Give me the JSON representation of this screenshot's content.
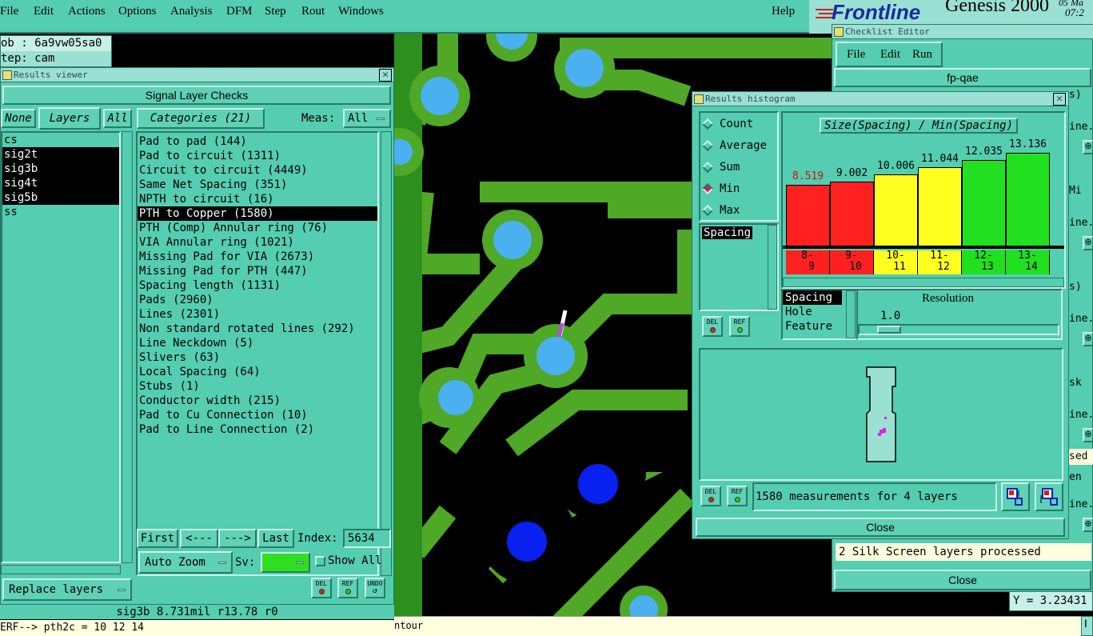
{
  "menubar": {
    "items": [
      "File",
      "Edit",
      "Actions",
      "Options",
      "Analysis",
      "DFM",
      "Step",
      "Rout",
      "Windows"
    ],
    "help": "Help"
  },
  "brand": {
    "logo": "Frontline",
    "product": "Genesis 2000",
    "clock_top": "05 Ma",
    "clock_bottom": "07:2"
  },
  "job_info": {
    "job": "ob : 6a9vw05sa0",
    "step": "tep: cam"
  },
  "results_viewer": {
    "title": "Results viewer",
    "header": "Signal Layer Checks",
    "none_label": "None",
    "layers_label": "Layers",
    "all_label": "All",
    "layers": [
      {
        "name": "cs",
        "selected": false
      },
      {
        "name": "sig2t",
        "selected": true
      },
      {
        "name": "sig3b",
        "selected": true
      },
      {
        "name": "sig4t",
        "selected": true
      },
      {
        "name": "sig5b",
        "selected": true
      },
      {
        "name": "ss",
        "selected": false
      }
    ],
    "categories_label": "Categories (21)",
    "meas_label": "Meas:",
    "meas_value": "All",
    "categories": [
      {
        "label": "Pad to pad (144)",
        "selected": false
      },
      {
        "label": "Pad to circuit (1311)",
        "selected": false
      },
      {
        "label": "Circuit to circuit (4449)",
        "selected": false
      },
      {
        "label": "Same Net Spacing (351)",
        "selected": false
      },
      {
        "label": "NPTH to circuit (16)",
        "selected": false
      },
      {
        "label": "PTH to Copper (1580)",
        "selected": true
      },
      {
        "label": "PTH (Comp) Annular ring (76)",
        "selected": false
      },
      {
        "label": "VIA Annular ring (1021)",
        "selected": false
      },
      {
        "label": "Missing Pad for VIA (2673)",
        "selected": false
      },
      {
        "label": "Missing Pad for PTH (447)",
        "selected": false
      },
      {
        "label": "Spacing length (1131)",
        "selected": false
      },
      {
        "label": "Pads (2960)",
        "selected": false
      },
      {
        "label": "Lines (2301)",
        "selected": false
      },
      {
        "label": "Non standard rotated lines (292)",
        "selected": false
      },
      {
        "label": "Line Neckdown (5)",
        "selected": false
      },
      {
        "label": "Slivers (63)",
        "selected": false
      },
      {
        "label": "Local Spacing (64)",
        "selected": false
      },
      {
        "label": "Stubs (1)",
        "selected": false
      },
      {
        "label": "Conductor width (215)",
        "selected": false
      },
      {
        "label": "Pad to Cu Connection (10)",
        "selected": false
      },
      {
        "label": "Pad to Line Connection (2)",
        "selected": false
      }
    ],
    "first_label": "First",
    "prev_label": "<---",
    "next_label": "--->",
    "last_label": "Last",
    "index_label": "Index:",
    "index_value": "5634",
    "auto_zoom_label": "Auto Zoom",
    "sv_label": "Sv:",
    "show_all_label": "Show All",
    "replace_layers_label": "Replace layers",
    "del_label": "DEL",
    "ref_label": "REF",
    "undo_label": "UNDO"
  },
  "status_line": "sig3b 8.731mil   r13.78   r0",
  "command_line": "ERF--> pth2c = 10 12 14",
  "bottom_status": "ntour",
  "coord_y": "Y = 3.23431",
  "histogram": {
    "title": "Results histogram",
    "radios": [
      {
        "label": "Count",
        "on": false
      },
      {
        "label": "Average",
        "on": false
      },
      {
        "label": "Sum",
        "on": false
      },
      {
        "label": "Min",
        "on": true
      },
      {
        "label": "Max",
        "on": false
      }
    ],
    "chart_title": "Size(Spacing) / Min(Spacing)",
    "measure_list": [
      "Spacing"
    ],
    "type_list": [
      {
        "label": "Spacing",
        "selected": true
      },
      {
        "label": "Hole",
        "selected": false
      },
      {
        "label": "Feature",
        "selected": false
      }
    ],
    "resolution_label": "Resolution",
    "resolution_value": "1.0",
    "summary": "1580 measurements for 4 layers",
    "close_label": "Close"
  },
  "chart_data": {
    "type": "bar",
    "title": "Size(Spacing) / Min(Spacing)",
    "categories": [
      "8-9",
      "9-10",
      "10-11",
      "11-12",
      "12-13",
      "13-14"
    ],
    "bin_labels": [
      [
        "8-",
        "9"
      ],
      [
        "9-",
        "10"
      ],
      [
        "10-",
        "11"
      ],
      [
        "11-",
        "12"
      ],
      [
        "12-",
        "13"
      ],
      [
        "13-",
        "14"
      ]
    ],
    "values": [
      8.519,
      9.002,
      10.006,
      11.044,
      12.035,
      13.136
    ],
    "value_labels": [
      "8.519",
      "9.002",
      "10.006",
      "11.044",
      "12.035",
      "13.136"
    ],
    "colors": [
      "#ff2020",
      "#ff2020",
      "#ffff20",
      "#ffff20",
      "#20e020",
      "#20e020"
    ],
    "label_colors": [
      "#d01010",
      "#000000",
      "#000000",
      "#000000",
      "#000000",
      "#000000"
    ],
    "ylim": [
      0,
      14.5
    ]
  },
  "checklist": {
    "title": "Checklist Editor",
    "menu": [
      "File",
      "Edit",
      "Run"
    ],
    "name": "fp-qae",
    "side_fragments": [
      "s)",
      "ine.",
      "Mi",
      "ine.",
      "s)",
      "ine.",
      "sk",
      "ine.",
      "sed",
      "en",
      "ine."
    ],
    "message": "2 Silk Screen layers processed",
    "close_label": "Close"
  },
  "colors": {
    "panel": "#55cdb0",
    "board": "#2a9a20",
    "copper": "#55bb20",
    "pad": "#4ab0f0",
    "via_blue": "#0820f0"
  }
}
